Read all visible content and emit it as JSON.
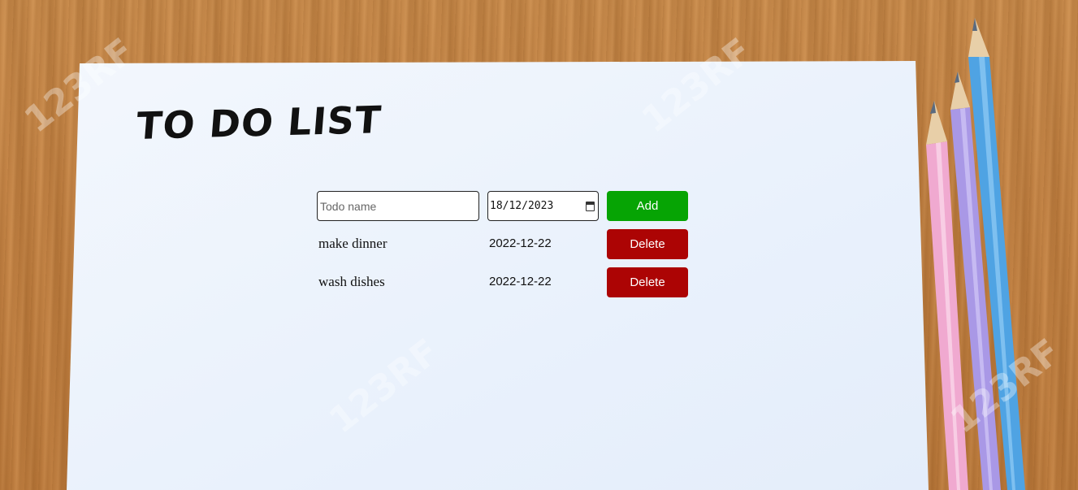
{
  "page": {
    "title": "TO DO LIST"
  },
  "form": {
    "name_placeholder": "Todo name",
    "name_value": "",
    "date_value": "18/12/2023",
    "add_label": "Add"
  },
  "todos": [
    {
      "name": "make dinner",
      "date": "2022-12-22",
      "delete_label": "Delete"
    },
    {
      "name": "wash dishes",
      "date": "2022-12-22",
      "delete_label": "Delete"
    }
  ],
  "watermark": "123RF",
  "colors": {
    "add_button": "#06a404",
    "delete_button": "#ac0404",
    "paper": "#eef4fd",
    "desk": "#c48243"
  },
  "icons": {
    "date_picker": "calendar-icon"
  }
}
